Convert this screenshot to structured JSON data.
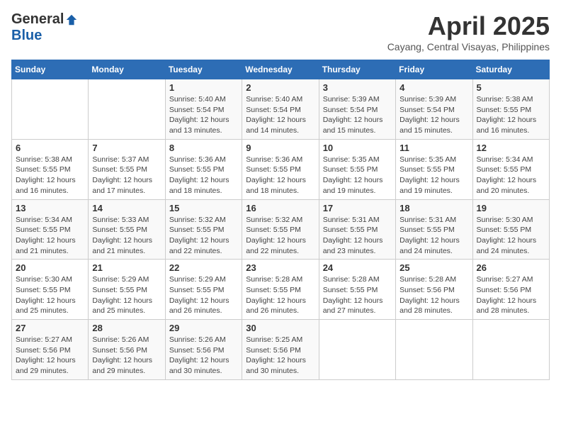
{
  "logo": {
    "general": "General",
    "blue": "Blue"
  },
  "header": {
    "title": "April 2025",
    "subtitle": "Cayang, Central Visayas, Philippines"
  },
  "weekdays": [
    "Sunday",
    "Monday",
    "Tuesday",
    "Wednesday",
    "Thursday",
    "Friday",
    "Saturday"
  ],
  "weeks": [
    [
      {
        "day": "",
        "info": ""
      },
      {
        "day": "",
        "info": ""
      },
      {
        "day": "1",
        "info": "Sunrise: 5:40 AM\nSunset: 5:54 PM\nDaylight: 12 hours and 13 minutes."
      },
      {
        "day": "2",
        "info": "Sunrise: 5:40 AM\nSunset: 5:54 PM\nDaylight: 12 hours and 14 minutes."
      },
      {
        "day": "3",
        "info": "Sunrise: 5:39 AM\nSunset: 5:54 PM\nDaylight: 12 hours and 15 minutes."
      },
      {
        "day": "4",
        "info": "Sunrise: 5:39 AM\nSunset: 5:54 PM\nDaylight: 12 hours and 15 minutes."
      },
      {
        "day": "5",
        "info": "Sunrise: 5:38 AM\nSunset: 5:55 PM\nDaylight: 12 hours and 16 minutes."
      }
    ],
    [
      {
        "day": "6",
        "info": "Sunrise: 5:38 AM\nSunset: 5:55 PM\nDaylight: 12 hours and 16 minutes."
      },
      {
        "day": "7",
        "info": "Sunrise: 5:37 AM\nSunset: 5:55 PM\nDaylight: 12 hours and 17 minutes."
      },
      {
        "day": "8",
        "info": "Sunrise: 5:36 AM\nSunset: 5:55 PM\nDaylight: 12 hours and 18 minutes."
      },
      {
        "day": "9",
        "info": "Sunrise: 5:36 AM\nSunset: 5:55 PM\nDaylight: 12 hours and 18 minutes."
      },
      {
        "day": "10",
        "info": "Sunrise: 5:35 AM\nSunset: 5:55 PM\nDaylight: 12 hours and 19 minutes."
      },
      {
        "day": "11",
        "info": "Sunrise: 5:35 AM\nSunset: 5:55 PM\nDaylight: 12 hours and 19 minutes."
      },
      {
        "day": "12",
        "info": "Sunrise: 5:34 AM\nSunset: 5:55 PM\nDaylight: 12 hours and 20 minutes."
      }
    ],
    [
      {
        "day": "13",
        "info": "Sunrise: 5:34 AM\nSunset: 5:55 PM\nDaylight: 12 hours and 21 minutes."
      },
      {
        "day": "14",
        "info": "Sunrise: 5:33 AM\nSunset: 5:55 PM\nDaylight: 12 hours and 21 minutes."
      },
      {
        "day": "15",
        "info": "Sunrise: 5:32 AM\nSunset: 5:55 PM\nDaylight: 12 hours and 22 minutes."
      },
      {
        "day": "16",
        "info": "Sunrise: 5:32 AM\nSunset: 5:55 PM\nDaylight: 12 hours and 22 minutes."
      },
      {
        "day": "17",
        "info": "Sunrise: 5:31 AM\nSunset: 5:55 PM\nDaylight: 12 hours and 23 minutes."
      },
      {
        "day": "18",
        "info": "Sunrise: 5:31 AM\nSunset: 5:55 PM\nDaylight: 12 hours and 24 minutes."
      },
      {
        "day": "19",
        "info": "Sunrise: 5:30 AM\nSunset: 5:55 PM\nDaylight: 12 hours and 24 minutes."
      }
    ],
    [
      {
        "day": "20",
        "info": "Sunrise: 5:30 AM\nSunset: 5:55 PM\nDaylight: 12 hours and 25 minutes."
      },
      {
        "day": "21",
        "info": "Sunrise: 5:29 AM\nSunset: 5:55 PM\nDaylight: 12 hours and 25 minutes."
      },
      {
        "day": "22",
        "info": "Sunrise: 5:29 AM\nSunset: 5:55 PM\nDaylight: 12 hours and 26 minutes."
      },
      {
        "day": "23",
        "info": "Sunrise: 5:28 AM\nSunset: 5:55 PM\nDaylight: 12 hours and 26 minutes."
      },
      {
        "day": "24",
        "info": "Sunrise: 5:28 AM\nSunset: 5:55 PM\nDaylight: 12 hours and 27 minutes."
      },
      {
        "day": "25",
        "info": "Sunrise: 5:28 AM\nSunset: 5:56 PM\nDaylight: 12 hours and 28 minutes."
      },
      {
        "day": "26",
        "info": "Sunrise: 5:27 AM\nSunset: 5:56 PM\nDaylight: 12 hours and 28 minutes."
      }
    ],
    [
      {
        "day": "27",
        "info": "Sunrise: 5:27 AM\nSunset: 5:56 PM\nDaylight: 12 hours and 29 minutes."
      },
      {
        "day": "28",
        "info": "Sunrise: 5:26 AM\nSunset: 5:56 PM\nDaylight: 12 hours and 29 minutes."
      },
      {
        "day": "29",
        "info": "Sunrise: 5:26 AM\nSunset: 5:56 PM\nDaylight: 12 hours and 30 minutes."
      },
      {
        "day": "30",
        "info": "Sunrise: 5:25 AM\nSunset: 5:56 PM\nDaylight: 12 hours and 30 minutes."
      },
      {
        "day": "",
        "info": ""
      },
      {
        "day": "",
        "info": ""
      },
      {
        "day": "",
        "info": ""
      }
    ]
  ]
}
